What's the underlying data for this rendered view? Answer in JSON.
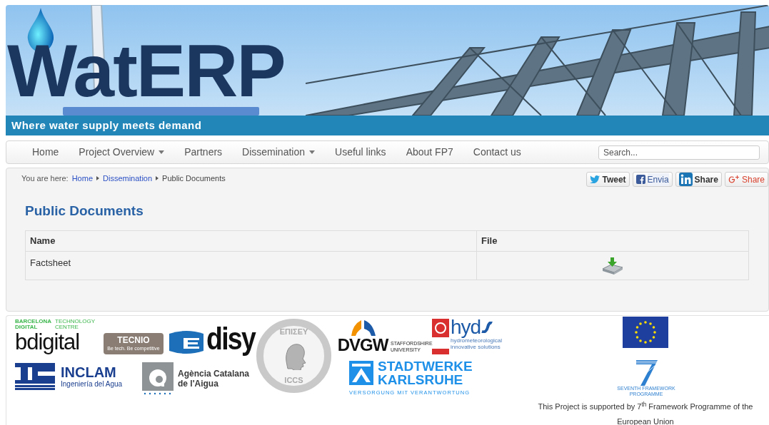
{
  "header": {
    "logo": "WatERP",
    "tagline": "Where water supply meets demand"
  },
  "nav": {
    "items": [
      {
        "label": "Home",
        "dropdown": false
      },
      {
        "label": "Project Overview",
        "dropdown": true
      },
      {
        "label": "Partners",
        "dropdown": false
      },
      {
        "label": "Dissemination",
        "dropdown": true
      },
      {
        "label": "Useful links",
        "dropdown": false
      },
      {
        "label": "About FP7",
        "dropdown": false
      },
      {
        "label": "Contact us",
        "dropdown": false
      }
    ],
    "search": {
      "placeholder": "Search..."
    }
  },
  "breadcrumb": {
    "prefix": "You are here:",
    "items": [
      {
        "label": "Home",
        "link": true
      },
      {
        "label": "Dissemination",
        "link": true
      },
      {
        "label": "Public Documents",
        "link": false
      }
    ]
  },
  "share_buttons": [
    {
      "kind": "twitter",
      "label": "Tweet"
    },
    {
      "kind": "facebook",
      "label": "Envia"
    },
    {
      "kind": "linkedin",
      "label": "Share"
    },
    {
      "kind": "googleplus",
      "label": "Share"
    }
  ],
  "page_title": "Public Documents",
  "table": {
    "columns": [
      "Name",
      "File"
    ],
    "rows": [
      {
        "name": "Factsheet"
      }
    ]
  },
  "partner_logos": [
    {
      "kind": "bdigital",
      "texts": [
        "BARCELONA DIGITAL",
        "TECHNOLOGY CENTRE",
        "bdigital"
      ]
    },
    {
      "kind": "tecnio",
      "texts": [
        "TECNIO",
        "Be tech. Be competitive"
      ]
    },
    {
      "kind": "emark"
    },
    {
      "kind": "disy",
      "texts": [
        "disy"
      ]
    },
    {
      "kind": "iccs",
      "texts": [
        "ΕΠΙΣΕΥ",
        "ICCS"
      ]
    },
    {
      "kind": "dvgw",
      "texts": [
        "DVGW"
      ]
    },
    {
      "kind": "staffordshire",
      "texts": [
        "STAFFORDSHIRE",
        "UNIVERSITY"
      ]
    },
    {
      "kind": "hydus",
      "texts": [
        "hyd",
        "hydrometeorological",
        "innovative solutions"
      ]
    },
    {
      "kind": "inclam",
      "texts": [
        "INCLAM",
        "Ingeniería del Agua"
      ]
    },
    {
      "kind": "aca",
      "texts": [
        "Agència Catalana",
        "de l'Aigua"
      ]
    },
    {
      "kind": "stadtwerke",
      "texts": [
        "STADTWERKE",
        "KARLSRUHE",
        "VERSORGUNG MIT VERANTWORTUNG"
      ]
    }
  ],
  "support_text": "This Project is supported by 7$^{th}$ Framework Programme of the European Union",
  "fp7_logo_text": [
    "SEVENTH FRAMEWORK",
    "PROGRAMME"
  ]
}
